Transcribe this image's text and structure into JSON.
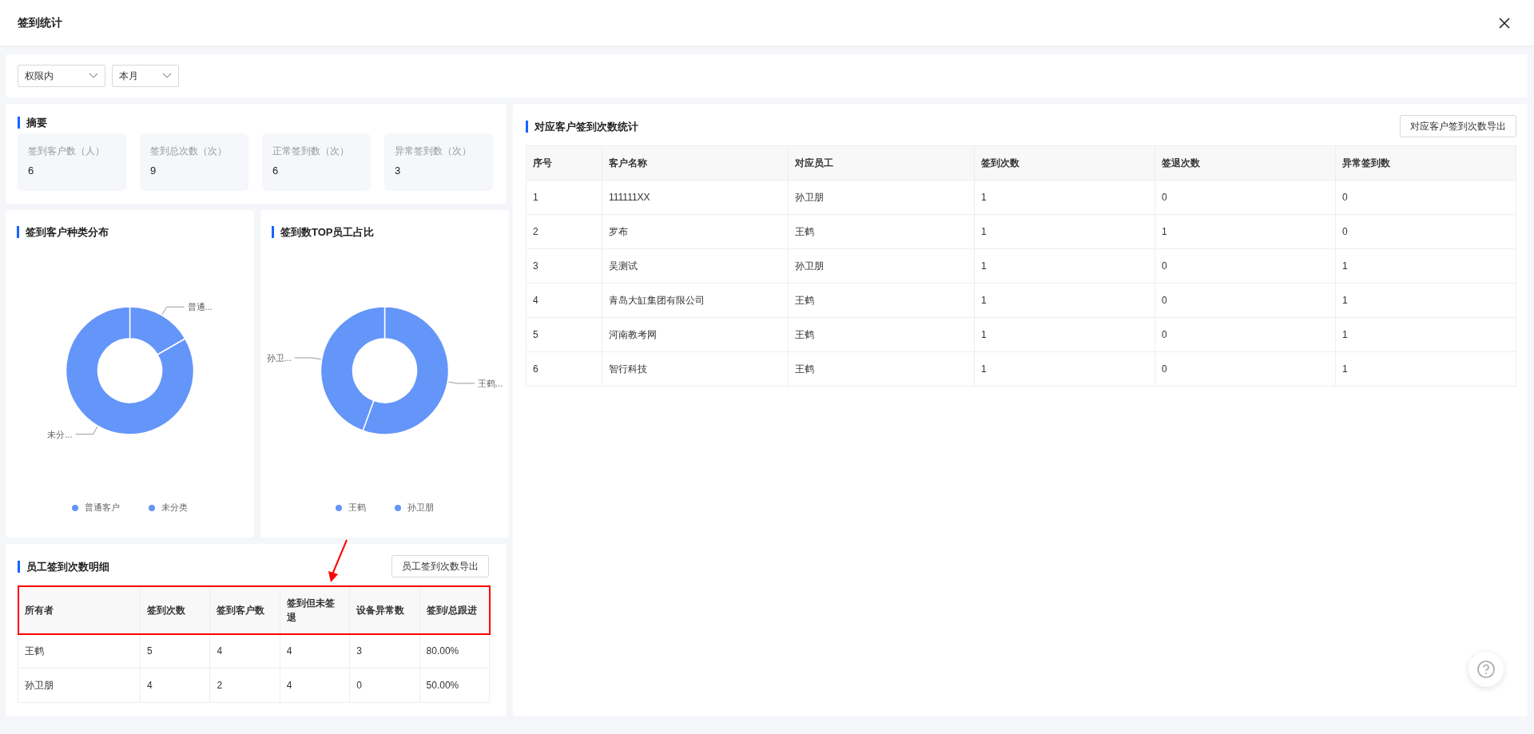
{
  "window": {
    "title": "签到统计"
  },
  "filters": [
    {
      "value": "权限内"
    },
    {
      "value": "本月"
    }
  ],
  "summary": {
    "title": "摘要",
    "stats": [
      {
        "label": "签到客户数（人）",
        "value": "6"
      },
      {
        "label": "签到总次数（次）",
        "value": "9"
      },
      {
        "label": "正常签到数（次）",
        "value": "6"
      },
      {
        "label": "异常签到数（次）",
        "value": "3"
      }
    ]
  },
  "charts": [
    {
      "title": "签到客户种类分布",
      "callouts": [
        "普通...",
        "未分..."
      ],
      "chart_data": {
        "type": "donut",
        "categories": [
          "普通客户",
          "未分类"
        ],
        "series": [
          {
            "color": "#6495f9",
            "values": [
              16.67,
              83.33
            ]
          }
        ]
      }
    },
    {
      "title": "签到数TOP员工占比",
      "callouts": [
        "王鹤...",
        "孙卫..."
      ],
      "chart_data": {
        "type": "donut",
        "categories": [
          "王鹤",
          "孙卫朋"
        ],
        "series": [
          {
            "color": "#6495f9",
            "values": [
              55.56,
              44.44
            ]
          }
        ]
      }
    }
  ],
  "employee_table": {
    "title": "员工签到次数明细",
    "export_button": "员工签到次数导出",
    "header_highlighted": true,
    "columns": [
      "所有者",
      "签到次数",
      "签到客户数",
      "签到但未签退",
      "设备异常数",
      "签到/总跟进"
    ],
    "rows": [
      [
        "王鹤",
        "5",
        "4",
        "4",
        "3",
        "80.00%"
      ],
      [
        "孙卫朋",
        "4",
        "2",
        "4",
        "0",
        "50.00%"
      ]
    ]
  },
  "customer_table": {
    "title": "对应客户签到次数统计",
    "export_button": "对应客户签到次数导出",
    "columns": [
      "序号",
      "客户名称",
      "对应员工",
      "签到次数",
      "签退次数",
      "异常签到数"
    ],
    "rows": [
      [
        "1",
        "111111XX",
        "孙卫朋",
        "1",
        "0",
        "0"
      ],
      [
        "2",
        "罗布",
        "王鹤",
        "1",
        "1",
        "0"
      ],
      [
        "3",
        "吴测试",
        "孙卫朋",
        "1",
        "0",
        "1"
      ],
      [
        "4",
        "青岛大缸集团有限公司",
        "王鹤",
        "1",
        "0",
        "1"
      ],
      [
        "5",
        "河南教考网",
        "王鹤",
        "1",
        "0",
        "1"
      ],
      [
        "6",
        "智行科技",
        "王鹤",
        "1",
        "0",
        "1"
      ]
    ]
  }
}
